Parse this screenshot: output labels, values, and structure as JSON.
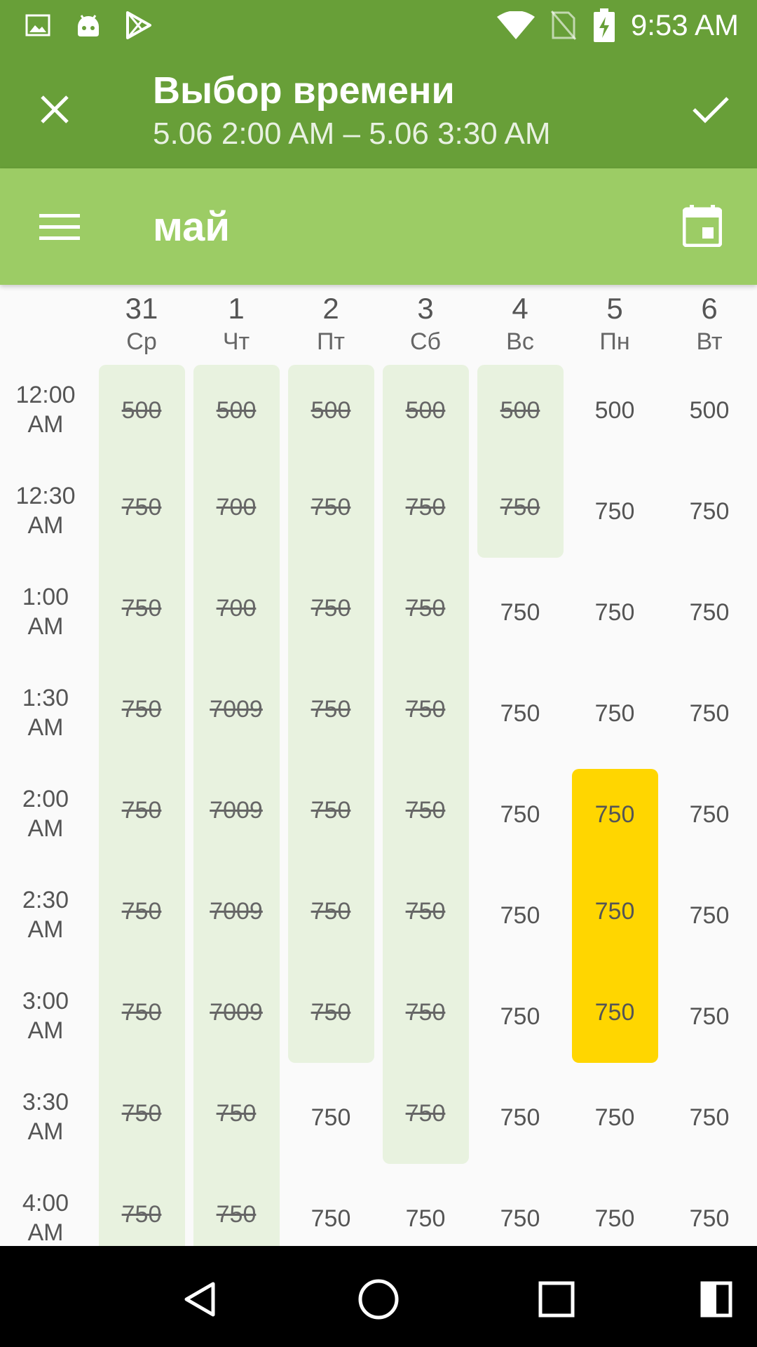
{
  "status_bar": {
    "time": "9:53 AM",
    "icons": [
      "image-icon",
      "android-icon",
      "play-store-icon",
      "wifi-icon",
      "no-sim-icon",
      "battery-charging-icon"
    ]
  },
  "toolbar": {
    "title": "Выбор времени",
    "subtitle": "5.06 2:00 AM – 5.06 3:30 AM",
    "close_icon": "close-icon",
    "confirm_icon": "check-icon"
  },
  "month_bar": {
    "title": "май",
    "menu_icon": "menu-icon",
    "calendar_icon": "calendar-icon"
  },
  "days": [
    {
      "num": "31",
      "name": "Ср"
    },
    {
      "num": "1",
      "name": "Чт"
    },
    {
      "num": "2",
      "name": "Пт"
    },
    {
      "num": "3",
      "name": "Сб"
    },
    {
      "num": "4",
      "name": "Вс"
    },
    {
      "num": "5",
      "name": "Пн"
    },
    {
      "num": "6",
      "name": "Вт"
    }
  ],
  "rows": [
    {
      "time": "12:00 AM",
      "cells": [
        {
          "v": "500",
          "s": "busy"
        },
        {
          "v": "500",
          "s": "busy"
        },
        {
          "v": "500",
          "s": "busy"
        },
        {
          "v": "500",
          "s": "busy"
        },
        {
          "v": "500",
          "s": "busy"
        },
        {
          "v": "500",
          "s": "free"
        },
        {
          "v": "500",
          "s": "free"
        }
      ]
    },
    {
      "time": "12:30 AM",
      "cells": [
        {
          "v": "750",
          "s": "busy"
        },
        {
          "v": "700",
          "s": "busy"
        },
        {
          "v": "750",
          "s": "busy"
        },
        {
          "v": "750",
          "s": "busy"
        },
        {
          "v": "750",
          "s": "busy"
        },
        {
          "v": "750",
          "s": "free"
        },
        {
          "v": "750",
          "s": "free"
        }
      ]
    },
    {
      "time": "1:00 AM",
      "cells": [
        {
          "v": "750",
          "s": "busy"
        },
        {
          "v": "700",
          "s": "busy"
        },
        {
          "v": "750",
          "s": "busy"
        },
        {
          "v": "750",
          "s": "busy"
        },
        {
          "v": "750",
          "s": "free"
        },
        {
          "v": "750",
          "s": "free"
        },
        {
          "v": "750",
          "s": "free"
        }
      ]
    },
    {
      "time": "1:30 AM",
      "cells": [
        {
          "v": "750",
          "s": "busy"
        },
        {
          "v": "7009",
          "s": "busy"
        },
        {
          "v": "750",
          "s": "busy"
        },
        {
          "v": "750",
          "s": "busy"
        },
        {
          "v": "750",
          "s": "free"
        },
        {
          "v": "750",
          "s": "free"
        },
        {
          "v": "750",
          "s": "free"
        }
      ]
    },
    {
      "time": "2:00 AM",
      "cells": [
        {
          "v": "750",
          "s": "busy"
        },
        {
          "v": "7009",
          "s": "busy"
        },
        {
          "v": "750",
          "s": "busy"
        },
        {
          "v": "750",
          "s": "busy"
        },
        {
          "v": "750",
          "s": "free"
        },
        {
          "v": "750",
          "s": "sel"
        },
        {
          "v": "750",
          "s": "free"
        }
      ]
    },
    {
      "time": "2:30 AM",
      "cells": [
        {
          "v": "750",
          "s": "busy"
        },
        {
          "v": "7009",
          "s": "busy"
        },
        {
          "v": "750",
          "s": "busy"
        },
        {
          "v": "750",
          "s": "busy"
        },
        {
          "v": "750",
          "s": "free"
        },
        {
          "v": "750",
          "s": "sel"
        },
        {
          "v": "750",
          "s": "free"
        }
      ]
    },
    {
      "time": "3:00 AM",
      "cells": [
        {
          "v": "750",
          "s": "busy"
        },
        {
          "v": "7009",
          "s": "busy"
        },
        {
          "v": "750",
          "s": "busy"
        },
        {
          "v": "750",
          "s": "busy"
        },
        {
          "v": "750",
          "s": "free"
        },
        {
          "v": "750",
          "s": "sel"
        },
        {
          "v": "750",
          "s": "free"
        }
      ]
    },
    {
      "time": "3:30 AM",
      "cells": [
        {
          "v": "750",
          "s": "busy"
        },
        {
          "v": "750",
          "s": "busy"
        },
        {
          "v": "750",
          "s": "free"
        },
        {
          "v": "750",
          "s": "busy"
        },
        {
          "v": "750",
          "s": "free"
        },
        {
          "v": "750",
          "s": "free"
        },
        {
          "v": "750",
          "s": "free"
        }
      ]
    },
    {
      "time": "4:00 AM",
      "cells": [
        {
          "v": "750",
          "s": "busy"
        },
        {
          "v": "750",
          "s": "busy"
        },
        {
          "v": "750",
          "s": "free"
        },
        {
          "v": "750",
          "s": "free"
        },
        {
          "v": "750",
          "s": "free"
        },
        {
          "v": "750",
          "s": "free"
        },
        {
          "v": "750",
          "s": "free"
        }
      ]
    }
  ],
  "colors": {
    "primary_dark": "#689f38",
    "primary_light": "#9ccc65",
    "busy_cell": "#e8f2df",
    "selected_cell": "#ffd600"
  },
  "nav_bar": {
    "icons": [
      "back-icon",
      "home-icon",
      "recents-icon",
      "split-screen-icon"
    ]
  }
}
